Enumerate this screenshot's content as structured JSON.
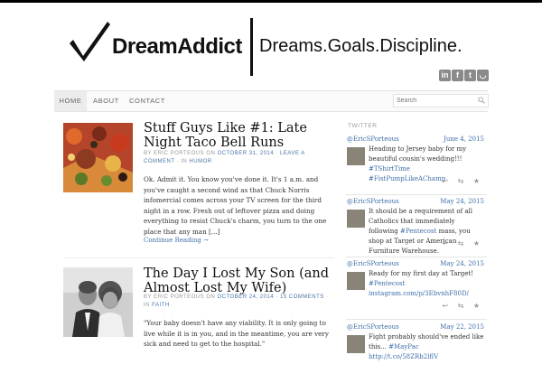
{
  "brand": {
    "name": "DreamAddict",
    "tagline": "Dreams.Goals.Discipline."
  },
  "social": [
    {
      "icon": "linkedin-icon",
      "glyph": "in"
    },
    {
      "icon": "facebook-icon",
      "glyph": "f"
    },
    {
      "icon": "twitter-icon",
      "glyph": "t"
    },
    {
      "icon": "rss-icon",
      "glyph": "◡"
    }
  ],
  "nav": {
    "home": "HOME",
    "about": "ABOUT",
    "contact": "CONTACT"
  },
  "search": {
    "placeholder": "Search"
  },
  "posts": [
    {
      "title": "Stuff Guys Like #1: Late Night Taco Bell Runs",
      "by": "BY",
      "author": "ERIC PORTEOUS",
      "on": "ON",
      "date": "OCTOBER 31, 2014",
      "sep": "·",
      "comments": "LEAVE A COMMENT",
      "in": "· IN",
      "category": "HUMOR",
      "excerpt": "Ok. Admit it. You know you've done it. It's 1 a.m. and you've caught a second wind as that Chuck Norris infomercial comes across your TV screen for the third night in a row. Fresh out of leftover pizza and doing everything to resist Chuck's charm, you turn to the one place that any man [...]",
      "more": "Continue Reading →"
    },
    {
      "title": "The Day I Lost My Son (and Almost Lost My Wife)",
      "by": "BY",
      "author": "ERIC PORTEOUS",
      "on": "ON",
      "date": "OCTOBER 24, 2014",
      "sep": "·",
      "comments": "15 COMMENTS",
      "in": "· IN",
      "category": "FAITH",
      "excerpt": "\"Your baby doesn't have any viability. It is only going to live while it is in you, and in the meantime, you are very sick and need to get to the hospital.\""
    }
  ],
  "twitter": {
    "heading": "TWITTER",
    "tweets": [
      {
        "handle": "@EricSPorteous",
        "date": "June 4, 2015",
        "text_before": "Heading to Jersey baby for my beautiful cousin's wedding!!! ",
        "hashtags": "#TShirtTime #FistPumpLikeAChamp",
        "text_after": ""
      },
      {
        "handle": "@EricSPorteous",
        "date": "May 24, 2015",
        "text_before": "It should be a requirement of all Catholics that immediately following ",
        "hashtags": "#Pentecost",
        "text_after": " mass, you shop at Target or American Furniture Warehouse."
      },
      {
        "handle": "@EricSPorteous",
        "date": "May 24, 2015",
        "text_before": "Ready for my first day at Target! ",
        "hashtags": "#Pentecost instagram.com/p/3EbvnhF80D/",
        "text_after": ""
      },
      {
        "handle": "@EricSPorteous",
        "date": "May 22, 2015",
        "text_before": "Fight probably should've ended like this... ",
        "hashtags": "#MayPac http://t.co/58ZRb2lflV",
        "text_after": ""
      }
    ],
    "actions": "↩ ⇆ ★"
  }
}
